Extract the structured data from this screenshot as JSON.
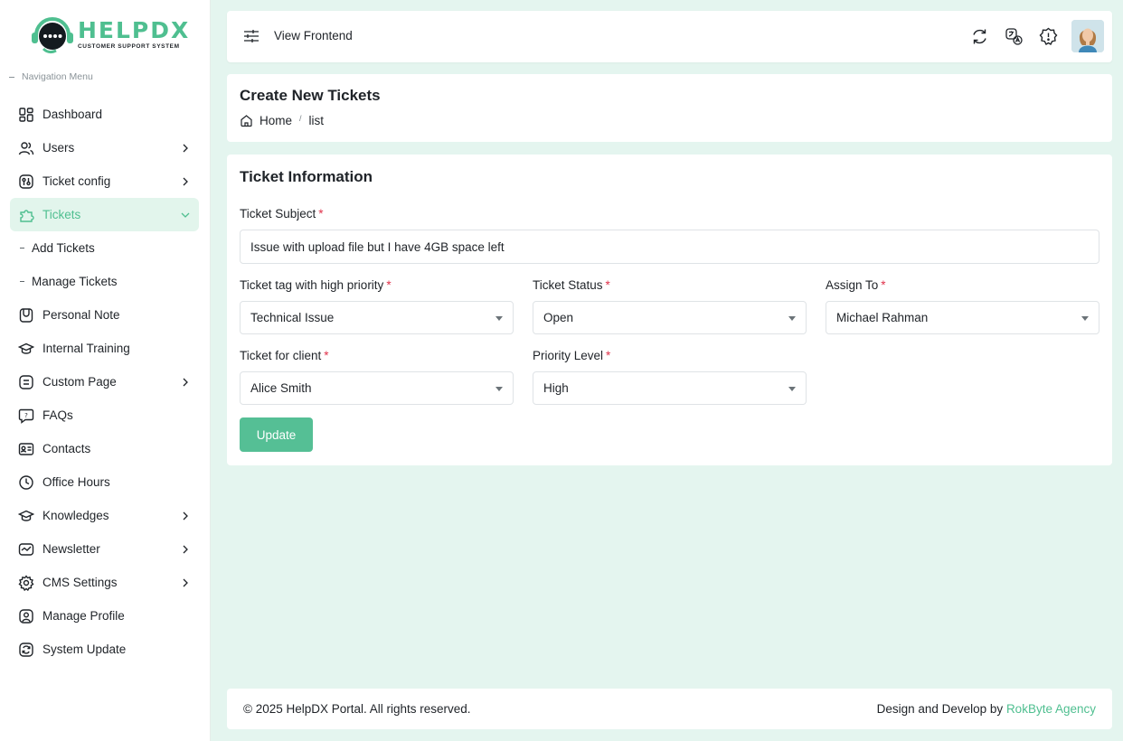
{
  "brand": {
    "name": "HELPDX",
    "tagline": "CUSTOMER SUPPORT SYSTEM",
    "accent": "#4fbf90"
  },
  "sidebar": {
    "heading": "Navigation Menu",
    "items": [
      {
        "label": "Dashboard",
        "icon": "dashboard-icon",
        "has_children": false
      },
      {
        "label": "Users",
        "icon": "users-icon",
        "has_children": true
      },
      {
        "label": "Ticket config",
        "icon": "ticket-config-icon",
        "has_children": true
      },
      {
        "label": "Tickets",
        "icon": "tickets-icon",
        "has_children": true,
        "active": true
      },
      {
        "label": "Personal Note",
        "icon": "note-icon",
        "has_children": false
      },
      {
        "label": "Internal Training",
        "icon": "training-icon",
        "has_children": false
      },
      {
        "label": "Custom Page",
        "icon": "page-icon",
        "has_children": true
      },
      {
        "label": "FAQs",
        "icon": "faq-icon",
        "has_children": false
      },
      {
        "label": "Contacts",
        "icon": "contacts-icon",
        "has_children": false
      },
      {
        "label": "Office Hours",
        "icon": "clock-icon",
        "has_children": false
      },
      {
        "label": "Knowledges",
        "icon": "knowledge-icon",
        "has_children": true
      },
      {
        "label": "Newsletter",
        "icon": "newsletter-icon",
        "has_children": true
      },
      {
        "label": "CMS Settings",
        "icon": "gear-icon",
        "has_children": true
      },
      {
        "label": "Manage Profile",
        "icon": "profile-icon",
        "has_children": false
      },
      {
        "label": "System Update",
        "icon": "update-icon",
        "has_children": false
      }
    ],
    "tickets_children": [
      "Add Tickets",
      "Manage Tickets"
    ]
  },
  "topbar": {
    "view_frontend": "View Frontend",
    "icons": [
      "sync-icon",
      "translate-icon",
      "alert-icon"
    ]
  },
  "page": {
    "title": "Create New Tickets",
    "breadcrumb": {
      "home": "Home",
      "current": "list"
    }
  },
  "form": {
    "title": "Ticket Information",
    "subject_label": "Ticket Subject",
    "subject_value": "Issue with upload file but I have 4GB space left",
    "tag_label": "Ticket tag with high priority",
    "tag_value": "Technical Issue",
    "status_label": "Ticket Status",
    "status_value": "Open",
    "assign_label": "Assign To",
    "assign_value": "Michael Rahman",
    "client_label": "Ticket for client",
    "client_value": "Alice Smith",
    "priority_label": "Priority Level",
    "priority_value": "High",
    "required_mark": "*",
    "submit_label": "Update"
  },
  "footer": {
    "copyright": "© 2025 HelpDX Portal. All rights reserved.",
    "credit_prefix": "Design and Develop by",
    "credit_link": "RokByte Agency"
  }
}
